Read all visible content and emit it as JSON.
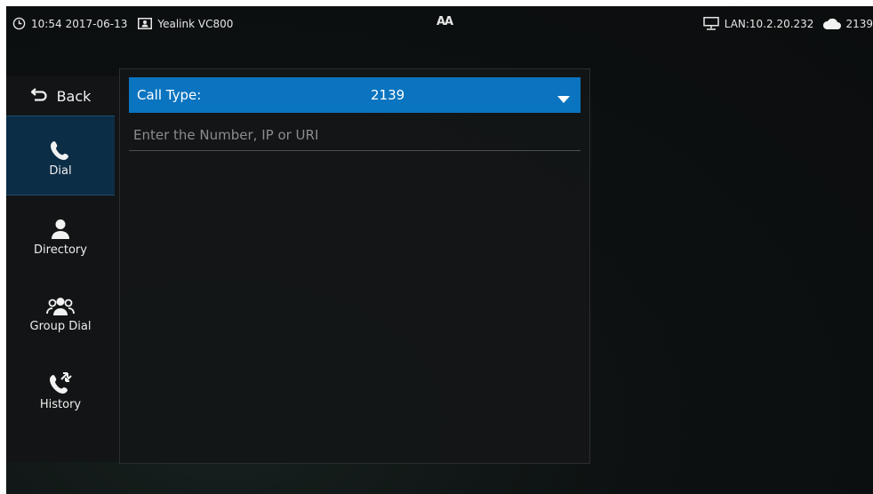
{
  "status_bar": {
    "time": "10:54",
    "date": "2017-06-13",
    "device_name": "Yealink VC800",
    "font_size_glyph": "AA",
    "lan_label": "LAN:10.2.20.232",
    "account": "2139",
    "icons": [
      "clock-icon",
      "contact-card-icon",
      "font-size-icon",
      "network-icon",
      "cloud-icon"
    ]
  },
  "sidebar": {
    "back_label": "Back",
    "items": [
      {
        "label": "Dial",
        "icon": "phone-icon",
        "active": true
      },
      {
        "label": "Directory",
        "icon": "person-icon",
        "active": false
      },
      {
        "label": "Group Dial",
        "icon": "group-icon",
        "active": false
      },
      {
        "label": "History",
        "icon": "call-history-icon",
        "active": false
      }
    ]
  },
  "dial_panel": {
    "call_type_label": "Call Type:",
    "call_type_value": "2139",
    "number_placeholder": "Enter the Number, IP or URI",
    "number_value": ""
  },
  "colors": {
    "accent": "#0a74c0",
    "active_nav": "#0c2d46",
    "background": "#0d1111"
  }
}
